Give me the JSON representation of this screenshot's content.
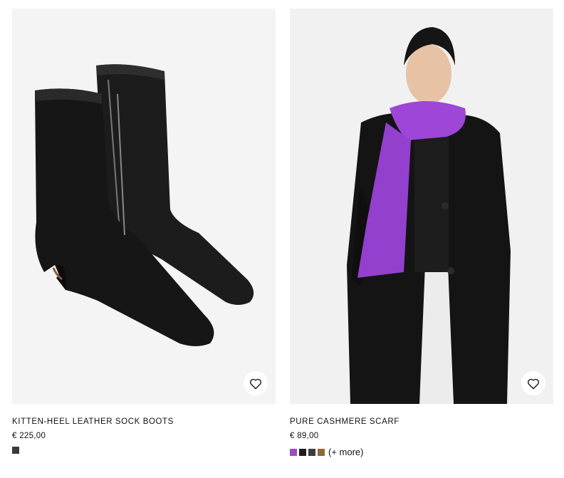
{
  "products": [
    {
      "title": "KITTEN-HEEL LEATHER SOCK BOOTS",
      "price": "€ 225,00",
      "wishlist_icon": "heart-outline-icon",
      "swatches": [
        {
          "name": "black",
          "color": "#3a3a3a"
        }
      ],
      "more_label": ""
    },
    {
      "title": "PURE CASHMERE SCARF",
      "price": "€ 89,00",
      "wishlist_icon": "heart-outline-icon",
      "swatches": [
        {
          "name": "purple",
          "color": "#9b4cc4"
        },
        {
          "name": "black",
          "color": "#1e1e1e"
        },
        {
          "name": "dark-grey",
          "color": "#3c3c3c"
        },
        {
          "name": "camel",
          "color": "#8c6a3a"
        }
      ],
      "more_label": "(+ more)"
    }
  ]
}
